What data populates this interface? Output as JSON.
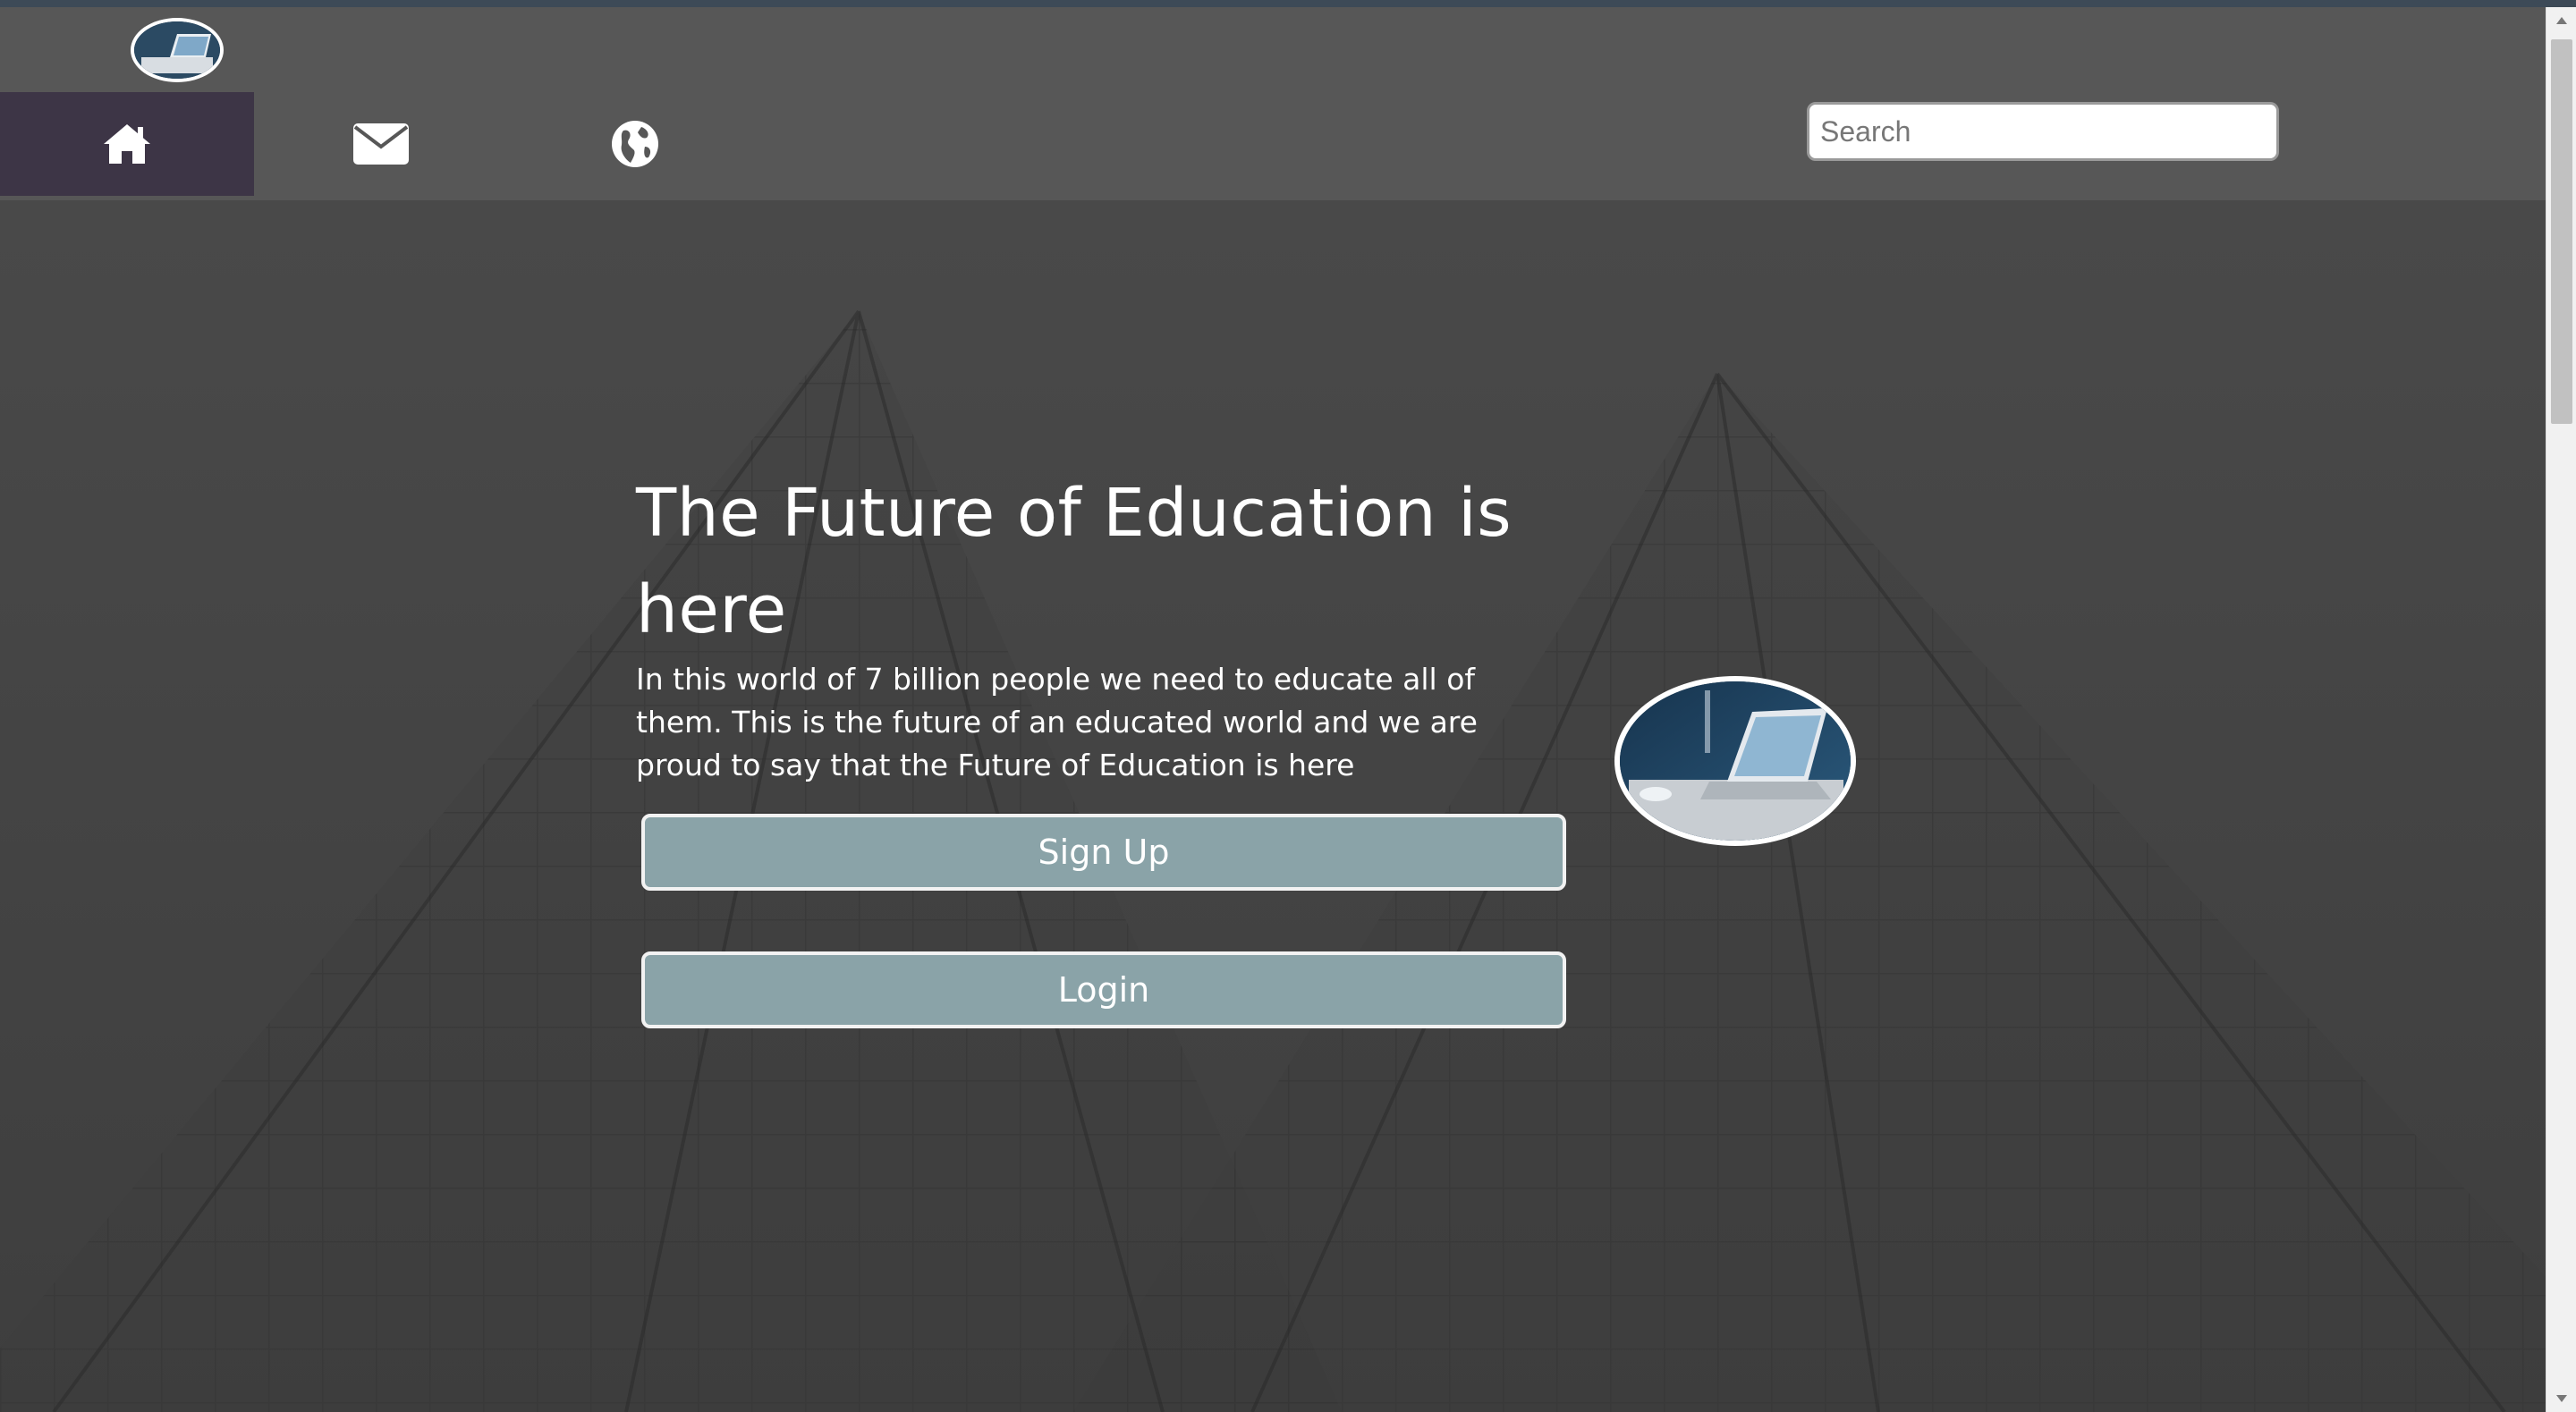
{
  "nav": {
    "items": [
      {
        "name": "home",
        "icon": "home-icon",
        "active": true
      },
      {
        "name": "mail",
        "icon": "envelope-icon",
        "active": false
      },
      {
        "name": "globe",
        "icon": "globe-icon",
        "active": false
      }
    ],
    "search_placeholder": "Search"
  },
  "hero": {
    "title": "The Future of Education is here",
    "text": "In this world of 7 billion people we need to educate all of them. This is the future of an educated world and we are proud to say that the Future of Education is here",
    "signup_label": "Sign Up",
    "login_label": "Login"
  },
  "colors": {
    "navbar": "#575757",
    "active_nav": "#3d3546",
    "button": "#8aa3a8"
  }
}
